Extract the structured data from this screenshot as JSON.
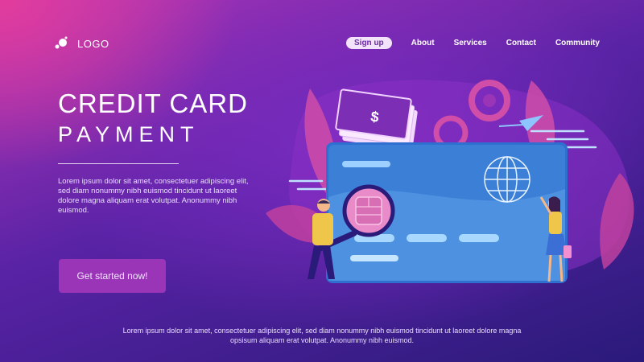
{
  "logo": {
    "text": "LOGO",
    "icon": "bubbles-logo-icon"
  },
  "nav": {
    "signup": "Sign up",
    "items": [
      "About",
      "Services",
      "Contact",
      "Community"
    ]
  },
  "hero": {
    "title_line1": "CREDIT CARD",
    "title_line2": "PAYMENT",
    "description": "Lorem ipsum dolor sit amet, consectetuer adipiscing elit, sed diam nonummy nibh euismod tincidunt ut laoreet dolore magna aliquam erat volutpat. Anonummy nibh euismod.",
    "cta": "Get started now!"
  },
  "footer": {
    "text": "Lorem ipsum dolor sit amet, consectetuer adipiscing elit, sed diam nonummy nibh euismod tincidunt ut laoreet dolore magna opsisum aliquam erat volutpat. Anonummy nibh euismod."
  },
  "illustration": {
    "banknote_symbol": "$",
    "icons": [
      "banknote-icon",
      "gear-icon",
      "paper-plane-icon",
      "globe-icon",
      "chip-icon",
      "magnifier-icon"
    ],
    "colors": {
      "card": "#3b7fd6",
      "leaf": "#d04da8",
      "accent": "#f18fd0"
    }
  }
}
